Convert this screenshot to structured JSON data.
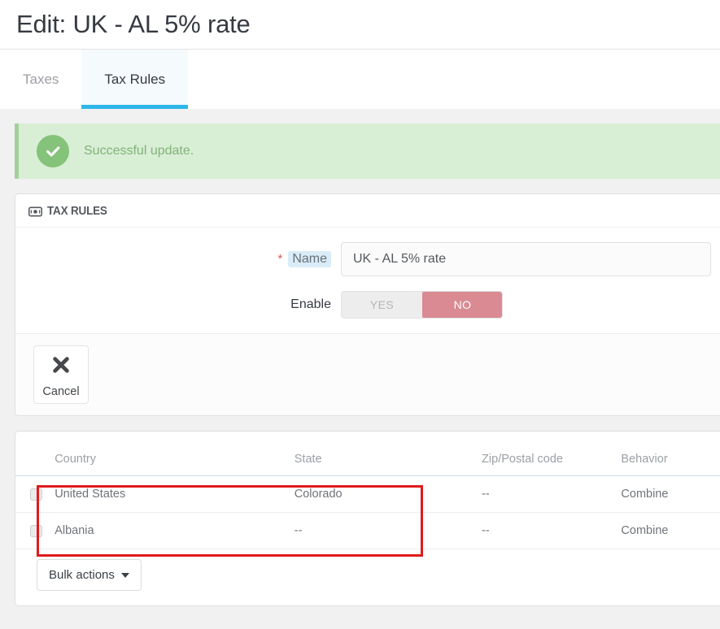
{
  "header": {
    "title": "Edit: UK - AL 5% rate"
  },
  "tabs": [
    {
      "label": "Taxes",
      "active": false
    },
    {
      "label": "Tax Rules",
      "active": true
    }
  ],
  "alert": {
    "message": "Successful update.",
    "icon": "check-circle-icon",
    "background_color": "#d8eed5",
    "accent_color": "#84c379",
    "text_color": "#82b379"
  },
  "panel": {
    "icon": "money-bill-icon",
    "title": "TAX RULES",
    "form": {
      "name": {
        "required_marker": "*",
        "label": "Name",
        "value": "UK - AL 5% rate",
        "placeholder": ""
      },
      "enable": {
        "label": "Enable",
        "options": [
          "YES",
          "NO"
        ],
        "selected": "NO",
        "on_color": "#d98a92",
        "off_color": "#ededed"
      }
    },
    "footer": {
      "cancel_label": "Cancel",
      "cancel_icon": "close-x-icon"
    }
  },
  "table": {
    "columns": [
      "",
      "Country",
      "State",
      "Zip/Postal code",
      "Behavior"
    ],
    "rows": [
      {
        "checked": false,
        "country": "United States",
        "state": "Colorado",
        "zip": "--",
        "behavior": "Combine"
      },
      {
        "checked": false,
        "country": "Albania",
        "state": "--",
        "zip": "--",
        "behavior": "Combine"
      }
    ],
    "bulk_actions_label": "Bulk actions"
  },
  "annotation": {
    "color": "#e01b1b",
    "target": "tax-rules-table-rows"
  }
}
